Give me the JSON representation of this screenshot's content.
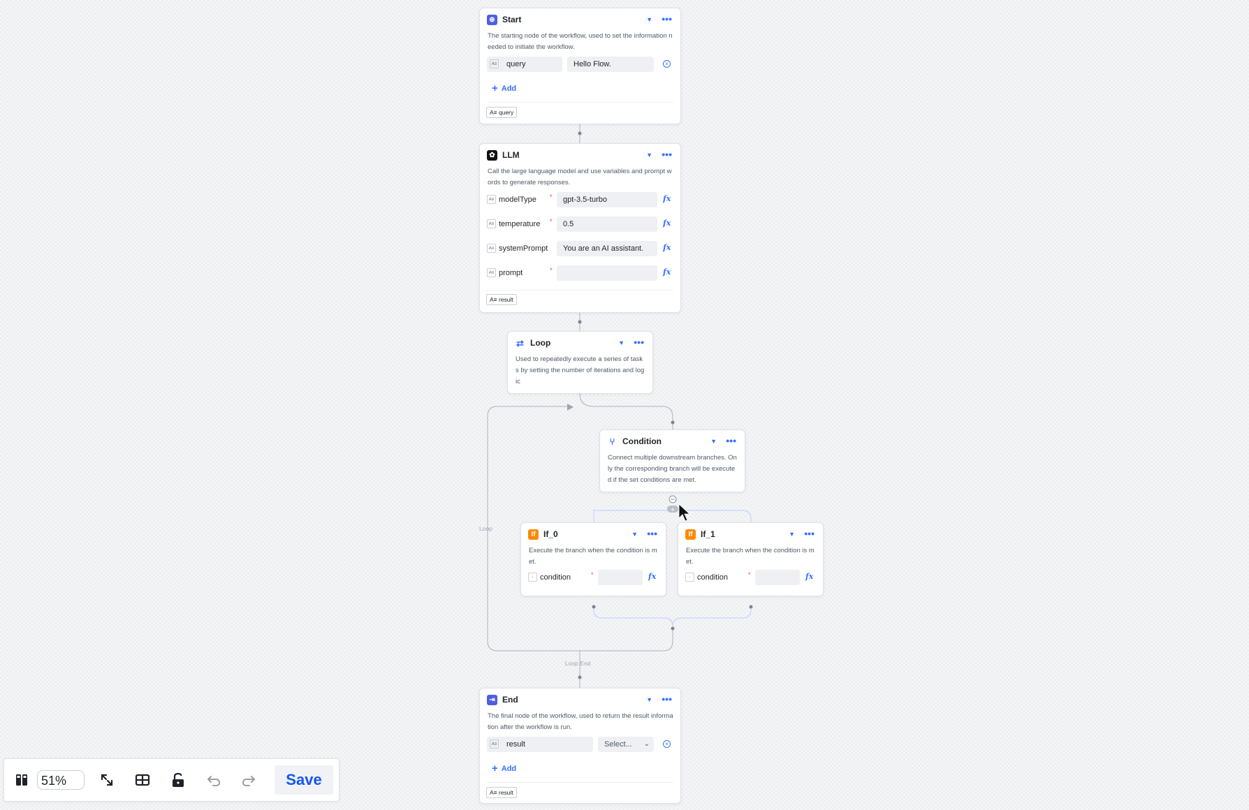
{
  "start": {
    "title": "Start",
    "description": "The starting node of the workflow, used to set the information needed to initiate the workflow.",
    "input_name": "query",
    "input_value": "Hello Flow.",
    "add_label": "Add",
    "output": "query",
    "var_tag": "A≡"
  },
  "llm": {
    "title": "LLM",
    "description": "Call the large language model and use variables and prompt words to generate responses.",
    "params": [
      {
        "name": "modelType",
        "value": "gpt-3.5-turbo",
        "required": "*"
      },
      {
        "name": "temperature",
        "value": "0.5",
        "required": "*"
      },
      {
        "name": "systemPrompt",
        "value": "You are an AI assistant.",
        "required": ""
      },
      {
        "name": "prompt",
        "value": "",
        "required": "*"
      }
    ],
    "fx": "fx",
    "output": "result"
  },
  "loop": {
    "title": "Loop",
    "description": "Used to repeatedly execute a series of tasks by setting the number of iterations and logic"
  },
  "condition": {
    "title": "Condition",
    "description": "Connect multiple downstream branches. Only the corresponding branch will be executed if the set conditions are met."
  },
  "if0": {
    "title": "If_0",
    "description": "Execute the branch when the condition is met.",
    "param": "condition",
    "required": "*"
  },
  "if1": {
    "title": "If_1",
    "description": "Execute the branch when the condition is met.",
    "param": "condition",
    "required": "*"
  },
  "end": {
    "title": "End",
    "description": "The final node of the workflow, used to return the result information after the workflow is run.",
    "output_name": "result",
    "select_placeholder": "Select...",
    "add_label": "Add",
    "output": "result"
  },
  "edges": {
    "loop_label": "Loop",
    "loop_end_label": "Loop End"
  },
  "toolbar": {
    "zoom": "51%",
    "save_label": "Save"
  },
  "colors": {
    "accent": "#3370ff",
    "required": "#f53f3f",
    "if_icon": "#ff8800",
    "start_icon": "#4e5de4"
  }
}
